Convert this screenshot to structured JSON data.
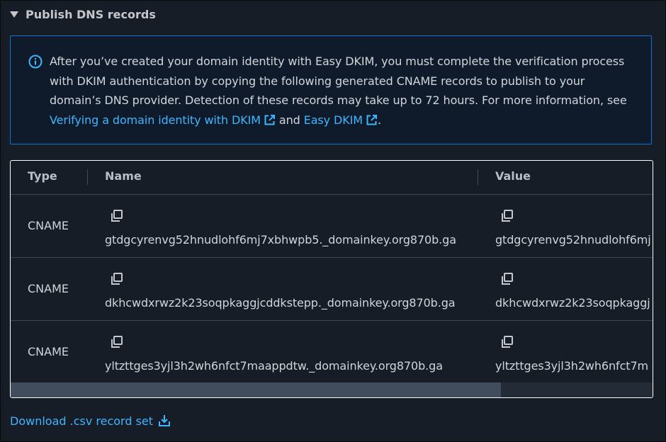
{
  "section": {
    "title": "Publish DNS records"
  },
  "info": {
    "text_before": "After you’ve created your domain identity with Easy DKIM, you must complete the verification process with DKIM authentication by copying the following generated CNAME records to publish to your domain’s DNS provider. Detection of these records may take up to 72 hours. For more information, see ",
    "link1": "Verifying a domain identity with DKIM",
    "text_between": " and ",
    "link2": "Easy DKIM",
    "text_after": "."
  },
  "table": {
    "columns": [
      "Type",
      "Name",
      "Value"
    ],
    "rows": [
      {
        "type": "CNAME",
        "name": "gtdgcyrenvg52hnudlohf6mj7xbhwpb5._domainkey.org870b.ga",
        "value": "gtdgcyrenvg52hnudlohf6mj"
      },
      {
        "type": "CNAME",
        "name": "dkhcwdxrwz2k23soqpkaggjcddkstepp._domainkey.org870b.ga",
        "value": "dkhcwdxrwz2k23soqpkaggj"
      },
      {
        "type": "CNAME",
        "name": "yltzttges3yjl3h2wh6nfct7maappdtw._domainkey.org870b.ga",
        "value": "yltzttges3yjl3h2wh6nfct7m"
      }
    ]
  },
  "download": {
    "label": "Download .csv record set"
  },
  "colors": {
    "link": "#42b4ff",
    "info_border": "#0972d3",
    "background": "#161d26"
  }
}
